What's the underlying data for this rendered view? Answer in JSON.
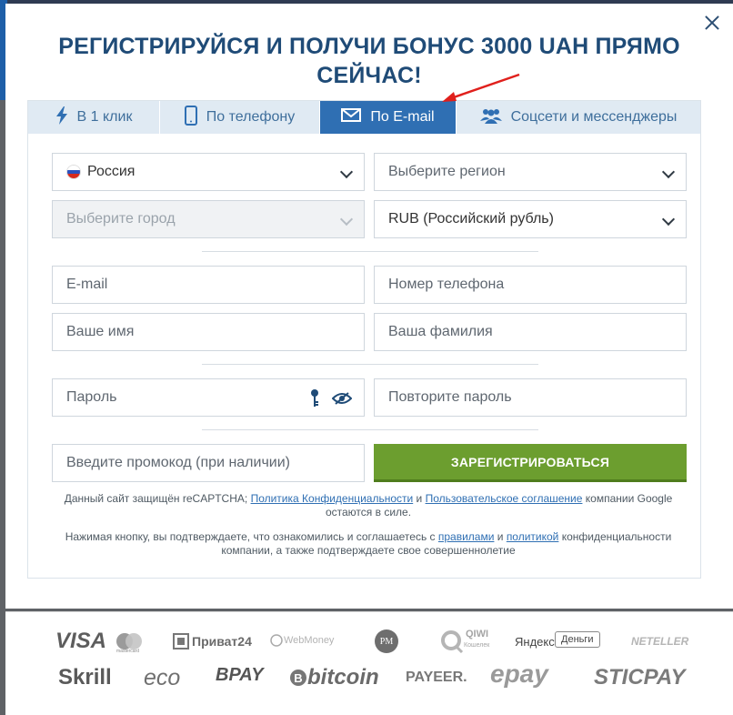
{
  "header": {
    "title": "РЕГИСТРИРУЙСЯ И ПОЛУЧИ БОНУС 3000 UAH ПРЯМО СЕЙЧАС!"
  },
  "tabs": [
    {
      "label": "В 1 клик",
      "icon": "lightning-icon"
    },
    {
      "label": "По телефону",
      "icon": "phone-icon"
    },
    {
      "label": "По E-mail",
      "icon": "envelope-icon",
      "active": true
    },
    {
      "label": "Соцсети и мессенджеры",
      "icon": "users-icon"
    }
  ],
  "form": {
    "country": "Россия",
    "region_placeholder": "Выберите регион",
    "city_placeholder": "Выберите город",
    "currency": "RUB (Российский рубль)",
    "email_placeholder": "E-mail",
    "phone_placeholder": "Номер телефона",
    "name_placeholder": "Ваше имя",
    "surname_placeholder": "Ваша фамилия",
    "password_placeholder": "Пароль",
    "password_repeat_placeholder": "Повторите пароль",
    "promo_placeholder": "Введите промокод (при наличии)",
    "register_label": "ЗАРЕГИСТРИРОВАТЬСЯ"
  },
  "notes": {
    "recaptcha_prefix": "Данный сайт защищён reCAPTCHA; ",
    "privacy_link": "Политика Конфиденциальности",
    "and1": " и ",
    "terms_link": "Пользовательское соглашение",
    "recaptcha_suffix": " компании Google",
    "recaptcha_line2": "остаются в силе.",
    "agree_prefix": "Нажимая кнопку, вы подтверждаете, что ознакомились и соглашаетесь с ",
    "rules_link": "правилами",
    "and2": " и ",
    "policy_link": "политикой",
    "agree_suffix": " конфиденциальности",
    "agree_line2": "компании, а также подтверждаете свое совершеннолетие"
  },
  "payments": {
    "visa": "VISA",
    "mastercard_caption": "mastercard",
    "privat": "Приват24",
    "webmoney": "WebMoney",
    "perfect_money": "PM",
    "qiwi": "QIWI",
    "qiwi_caption": "Кошелек",
    "yandex": "Яндекс",
    "yandex_money": "Деньги",
    "neteller": "NETELLER",
    "skrill": "Skrill",
    "ecopayz": "eco",
    "bpay": "BPAY",
    "bitcoin": "bitcoin",
    "payeer": "PAYEER.",
    "epay": "epay",
    "sticpay": "STICPAY"
  },
  "colors": {
    "accent": "#2f6fb3",
    "title": "#1f4b77",
    "register": "#6c9e2f",
    "annotation_arrow": "#e0201c"
  }
}
